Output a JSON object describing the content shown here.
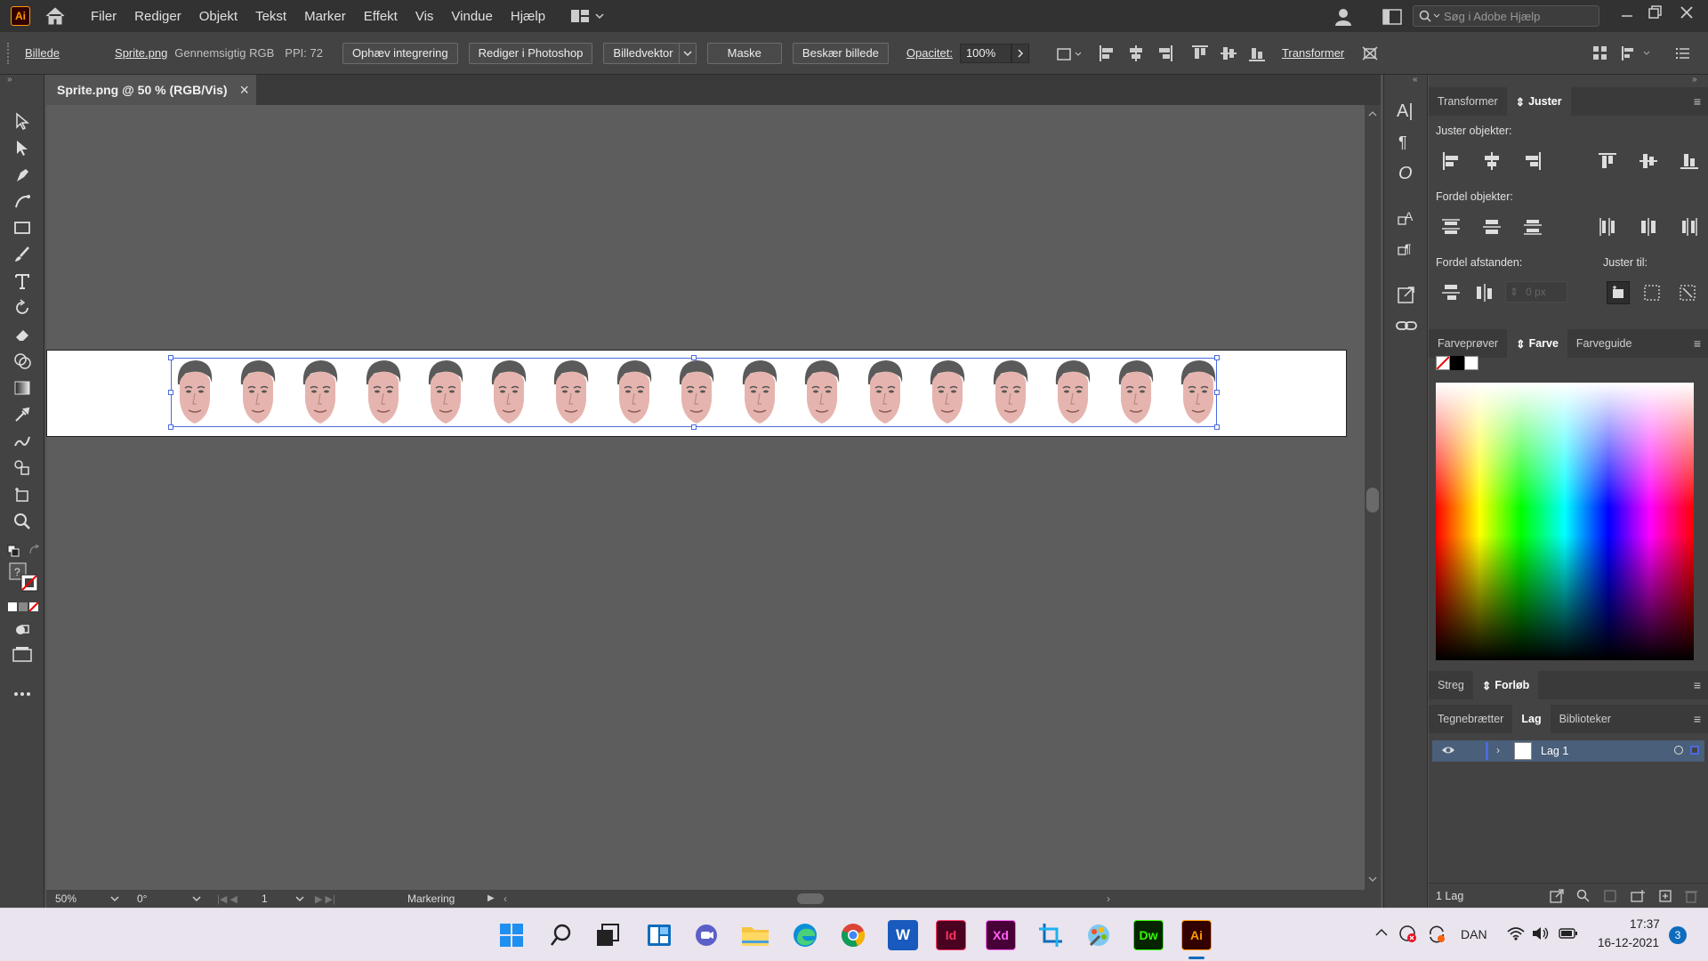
{
  "app": {
    "logo_text": "Ai",
    "search_placeholder": "Søg i Adobe Hjælp"
  },
  "menu": [
    "Filer",
    "Rediger",
    "Objekt",
    "Tekst",
    "Marker",
    "Effekt",
    "Vis",
    "Vindue",
    "Hjælp"
  ],
  "control_bar": {
    "object_type": "Billede",
    "file_name": "Sprite.png",
    "color_mode": "Gennemsigtig RGB",
    "ppi": "PPI: 72",
    "unembed_button": "Ophæv integrering",
    "edit_photoshop_button": "Rediger i Photoshop",
    "image_trace_button": "Billedvektor",
    "mask_button": "Maske",
    "crop_button": "Beskær billede",
    "opacity_label": "Opacitet:",
    "opacity_value": "100%",
    "transform_label": "Transformer"
  },
  "document_tab": {
    "title": "Sprite.png @ 50 % (RGB/Vis)",
    "close": "×"
  },
  "status_bar": {
    "zoom": "50%",
    "rotation": "0°",
    "artboard": "1",
    "tool_mode": "Markering"
  },
  "panels": {
    "transform_tabs": [
      "Transformer",
      "Juster"
    ],
    "align_objects_label": "Juster objekter:",
    "distribute_objects_label": "Fordel objekter:",
    "distribute_spacing_label": "Fordel afstanden:",
    "align_to_label": "Juster til:",
    "spacing_value": "0 px",
    "color_tabs": [
      "Farveprøver",
      "Farve",
      "Farveguide"
    ],
    "stroke_tabs": [
      "Streg",
      "Forløb"
    ],
    "layer_tabs": [
      "Tegnebrætter",
      "Lag",
      "Biblioteker"
    ],
    "layer_name": "Lag 1",
    "layer_count": "1 Lag"
  },
  "artboard": {
    "sprite_count": 17
  },
  "taskbar": {
    "apps": [
      "start-icon",
      "search-icon",
      "task-view-icon",
      "widgets-icon",
      "chat-icon",
      "file-explorer-icon",
      "edge-icon",
      "chrome-icon",
      "word-icon",
      "indesign-icon",
      "xd-icon",
      "snipping-icon",
      "paint-icon",
      "dreamweaver-icon",
      "illustrator-icon"
    ],
    "app_labels": {
      "word": "W",
      "indesign": "Id",
      "xd": "Xd",
      "dreamweaver": "Dw",
      "illustrator": "Ai"
    },
    "language": "DAN",
    "time": "17:37",
    "date": "16-12-2021",
    "notification_count": "3"
  },
  "colors": {
    "accent_selection": "#4a6bdf",
    "ai_orange": "#ff9a00",
    "indesign": "#ff3366",
    "xd": "#ff61f6",
    "dreamweaver": "#35fa00"
  }
}
